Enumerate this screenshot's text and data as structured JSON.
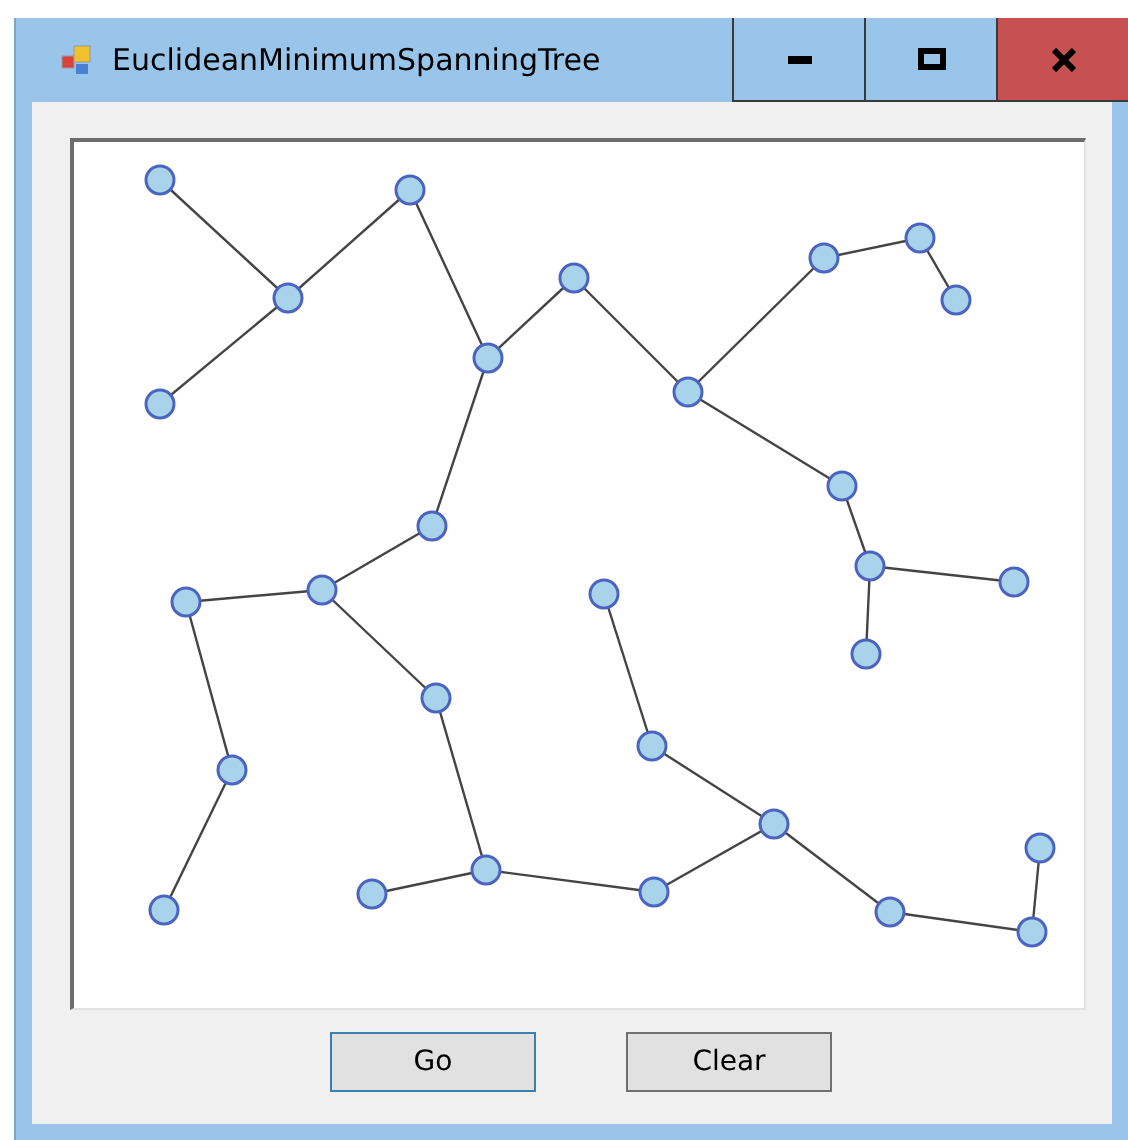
{
  "window": {
    "title": "EuclideanMinimumSpanningTree"
  },
  "buttons": [
    {
      "label": "Go",
      "focused": true
    },
    {
      "label": "Clear",
      "focused": false
    }
  ]
}
